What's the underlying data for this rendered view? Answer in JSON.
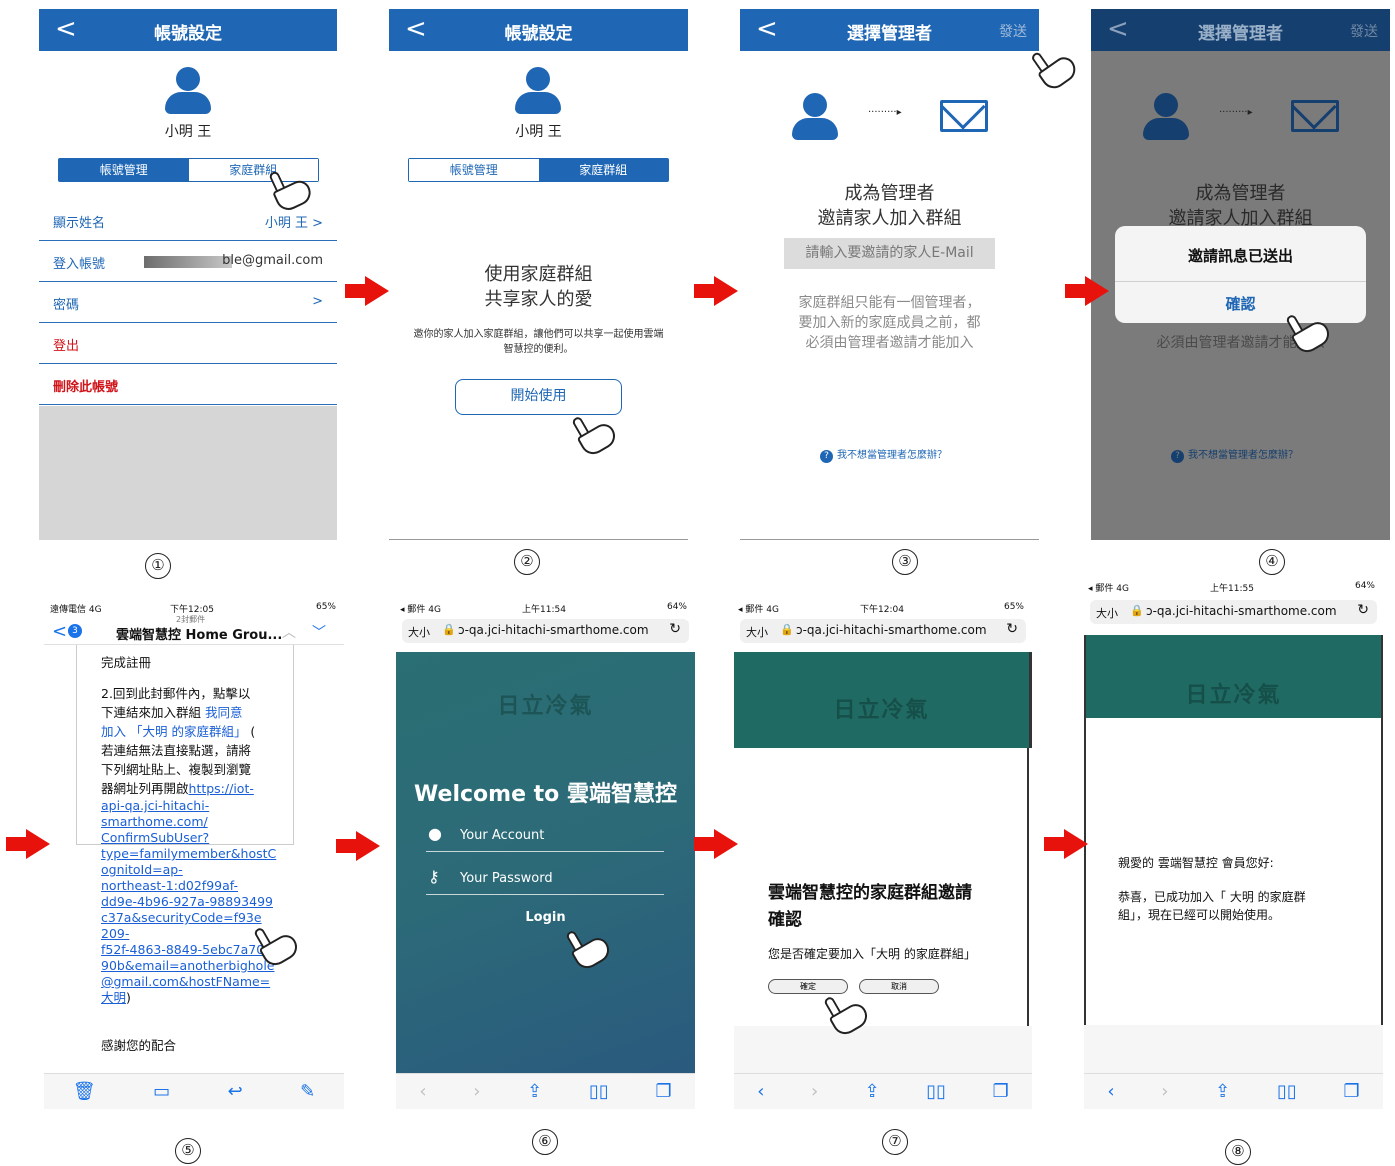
{
  "s1": {
    "title": "帳號設定",
    "back": "<",
    "user": "小明 王",
    "tab_manage": "帳號管理",
    "tab_family": "家庭群組",
    "row_name": "顯示姓名",
    "row_name_val": "小明 王 >",
    "row_login": "登入帳號",
    "row_login_val": "ble@gmail.com",
    "row_pwd": "密碼",
    "row_pwd_val": ">",
    "row_logout": "登出",
    "row_delete": "刪除此帳號"
  },
  "s2": {
    "title": "帳號設定",
    "back": "<",
    "user": "小明 王",
    "tab_manage": "帳號管理",
    "tab_family": "家庭群組",
    "head1": "使用家庭群組",
    "head2": "共享家人的愛",
    "desc1": "邀你的家人加入家庭群組，讓他們可以共享一起使用雲端",
    "desc2": "智慧控的便利。",
    "start": "開始使用"
  },
  "s3": {
    "title": "選擇管理者",
    "back": "<",
    "send": "發送",
    "dots": "·········▸",
    "h1": "成為管理者",
    "h2": "邀請家人加入群組",
    "input_placeholder": "請輸入要邀請的家人E-Mail",
    "p1": "家庭群組只能有一個管理者，",
    "p2": "要加入新的家庭成員之前，都",
    "p3": "必須由管理者邀請才能加入",
    "help": "我不想當管理者怎麼辦？",
    "q": "?"
  },
  "s4": {
    "title": "選擇管理者",
    "back": "<",
    "send": "發送",
    "dots": "·········▸",
    "h1": "成為管理者",
    "h2": "邀請家人加入群組",
    "p3": "必須由管理者邀請才能加入",
    "help": "我不想當管理者怎麼辦？",
    "q": "?",
    "dialog_title": "邀請訊息已送出",
    "dialog_ok": "確認"
  },
  "s5": {
    "status_l": "遠傳電信 4G",
    "time": "下午12:05",
    "status_r": "65%",
    "mail_count": "2封郵件",
    "badge": "3",
    "subject": "雲端智慧控 Home Grou...",
    "line0": "完成註冊",
    "t1": "2.回到此封郵件內，點擊以",
    "t2": "下連結來加入群組 ",
    "t2l": "我同意",
    "t3l": "加入 「大明 的家庭群組」",
    "t3": " (",
    "t4": "若連結無法直接點選，請將",
    "t5": "下列網址貼上、複製到瀏覽",
    "t6": "器網址列再開啟",
    "url": [
      "https://iot-",
      "api-qa.jci-hitachi-",
      "smarthome.com/",
      "ConfirmSubUser?",
      "type=familymember&hostC",
      "ognitoId=ap-",
      "northeast-1:d02f99af-",
      "dd9e-4b96-927a-98893499",
      "c37a&securityCode=f93e",
      "209-",
      "f52f-4863-8849-5ebc7a70a",
      "90b&email=anotherbighole",
      "@gmail.com&hostFName=",
      "大明"
    ],
    "close_paren": ")",
    "thanks": "感謝您的配合"
  },
  "s6": {
    "status_l": "◂ 郵件 4G",
    "time": "上午11:54",
    "status_r": "64%",
    "size": "大小",
    "url": "ɔ-qa.jci-hitachi-smarthome.com",
    "brand": "日立冷氣",
    "welcome": "Welcome to 雲端智慧控",
    "account": "Your Account",
    "password": "Your Password",
    "login": "Login"
  },
  "s7": {
    "status_l": "◂ 郵件 4G",
    "time": "下午12:04",
    "status_r": "65%",
    "size": "大小",
    "url": "ɔ-qa.jci-hitachi-smarthome.com",
    "brand": "日立冷氣",
    "heading1": "雲端智慧控的家庭群組邀請",
    "heading2": "確認",
    "question": "您是否確定要加入「大明 的家庭群組」",
    "ok": "確定",
    "cancel": "取消"
  },
  "s8": {
    "status_l": "◂ 郵件 4G",
    "time": "上午11:55",
    "status_r": "64%",
    "size": "大小",
    "url": "ɔ-qa.jci-hitachi-smarthome.com",
    "brand": "日立冷氣",
    "greet": "親愛的 雲端智慧控 會員您好:",
    "msg1": "恭喜，已成功加入「 大明 的家庭群",
    "msg2": "組」，現在已經可以開始使用。"
  },
  "steps": [
    "①",
    "②",
    "③",
    "④",
    "⑤",
    "⑥",
    "⑦",
    "⑧"
  ],
  "colors": {
    "header": "#1f67b5",
    "teal": "#1f6b63",
    "arrow": "#e8120c"
  }
}
